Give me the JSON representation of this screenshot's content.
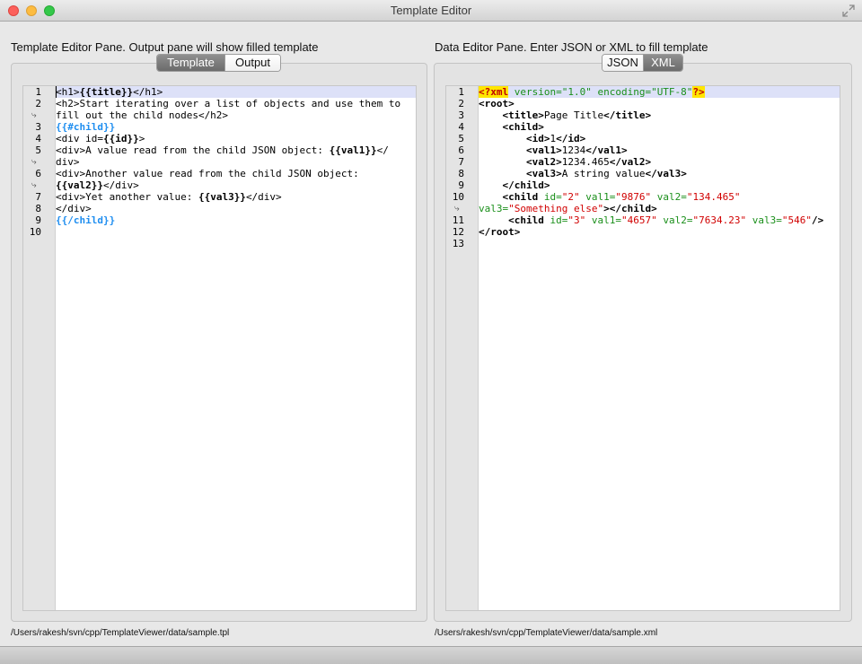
{
  "window": {
    "title": "Template Editor"
  },
  "left_pane": {
    "label": "Template Editor Pane.  Output pane will show filled template",
    "tabs": [
      {
        "label": "Template",
        "active": true
      },
      {
        "label": "Output",
        "active": false
      }
    ],
    "file_path": "/Users/rakesh/svn/cpp/TemplateViewer/data/sample.tpl",
    "line_numbers": [
      "1",
      "2",
      "",
      "3",
      "4",
      "5",
      "",
      "6",
      "",
      "7",
      "8",
      "9",
      "10"
    ],
    "wrapped_rows": [
      2,
      6,
      8
    ]
  },
  "right_pane": {
    "label": "Data Editor Pane.  Enter JSON or XML to fill template",
    "tabs": [
      {
        "label": "JSON",
        "active": false
      },
      {
        "label": "XML",
        "active": true
      }
    ],
    "file_path": "/Users/rakesh/svn/cpp/TemplateViewer/data/sample.xml",
    "line_numbers": [
      "1",
      "2",
      "3",
      "4",
      "5",
      "6",
      "7",
      "8",
      "9",
      "10",
      "",
      "11",
      "12",
      "13"
    ],
    "wrapped_rows": [
      10
    ]
  },
  "template_code": [
    [
      [
        "",
        "<h1>"
      ],
      [
        "b",
        "{{title}}"
      ],
      [
        "",
        "</h1>"
      ]
    ],
    [
      [
        "",
        "<h2>Start iterating over a list of objects and use them to"
      ]
    ],
    [
      [
        "",
        "fill out the child nodes</h2>"
      ]
    ],
    [
      [
        "sec",
        "{{#child}}"
      ]
    ],
    [
      [
        "",
        "<div id="
      ],
      [
        "b",
        "{{id}}"
      ],
      [
        "",
        ">"
      ]
    ],
    [
      [
        "",
        "<div>A value read from the child JSON object: "
      ],
      [
        "b",
        "{{val1}}"
      ],
      [
        "",
        "</"
      ]
    ],
    [
      [
        "",
        "div>"
      ]
    ],
    [
      [
        "",
        "<div>Another value read from the child JSON object:"
      ]
    ],
    [
      [
        "b",
        "{{val2}}"
      ],
      [
        "",
        "</div>"
      ]
    ],
    [
      [
        "",
        "<div>Yet another value: "
      ],
      [
        "b",
        "{{val3}}"
      ],
      [
        "",
        "</div>"
      ]
    ],
    [
      [
        "",
        "</div>"
      ]
    ],
    [
      [
        "sec",
        "{{/child}}"
      ]
    ],
    [
      [
        "",
        ""
      ]
    ]
  ],
  "xml_code": [
    [
      [
        "pi",
        "<?xml"
      ],
      [
        "attr",
        " version=\"1.0\" encoding=\"UTF-8\""
      ],
      [
        "pi",
        "?>"
      ]
    ],
    [
      [
        "b",
        "<root>"
      ]
    ],
    [
      [
        "",
        "    "
      ],
      [
        "b",
        "<title>"
      ],
      [
        "",
        "Page Title"
      ],
      [
        "b",
        "</title>"
      ]
    ],
    [
      [
        "",
        "    "
      ],
      [
        "b",
        "<child>"
      ]
    ],
    [
      [
        "",
        "        "
      ],
      [
        "b",
        "<id>"
      ],
      [
        "",
        "1"
      ],
      [
        "b",
        "</id>"
      ]
    ],
    [
      [
        "",
        "        "
      ],
      [
        "b",
        "<val1>"
      ],
      [
        "",
        "1234"
      ],
      [
        "b",
        "</val1>"
      ]
    ],
    [
      [
        "",
        "        "
      ],
      [
        "b",
        "<val2>"
      ],
      [
        "",
        "1234.465"
      ],
      [
        "b",
        "</val2>"
      ]
    ],
    [
      [
        "",
        "        "
      ],
      [
        "b",
        "<val3>"
      ],
      [
        "",
        "A string value"
      ],
      [
        "b",
        "</val3>"
      ]
    ],
    [
      [
        "",
        "    "
      ],
      [
        "b",
        "</child>"
      ]
    ],
    [
      [
        "",
        "    "
      ],
      [
        "b",
        "<child"
      ],
      [
        "attr",
        " id="
      ],
      [
        "str",
        "\"2\""
      ],
      [
        "attr",
        " val1="
      ],
      [
        "str",
        "\"9876\""
      ],
      [
        "attr",
        " val2="
      ],
      [
        "str",
        "\"134.465\""
      ]
    ],
    [
      [
        "attr",
        "val3="
      ],
      [
        "str",
        "\"Something else\""
      ],
      [
        "b",
        "></child>"
      ]
    ],
    [
      [
        "",
        "     "
      ],
      [
        "b",
        "<child"
      ],
      [
        "attr",
        " id="
      ],
      [
        "str",
        "\"3\""
      ],
      [
        "attr",
        " val1="
      ],
      [
        "str",
        "\"4657\""
      ],
      [
        "attr",
        " val2="
      ],
      [
        "str",
        "\"7634.23\""
      ],
      [
        "attr",
        " val3="
      ],
      [
        "str",
        "\"546\""
      ],
      [
        "b",
        "/>"
      ]
    ],
    [
      [
        "b",
        "</root>"
      ]
    ],
    [
      [
        "",
        ""
      ]
    ]
  ]
}
